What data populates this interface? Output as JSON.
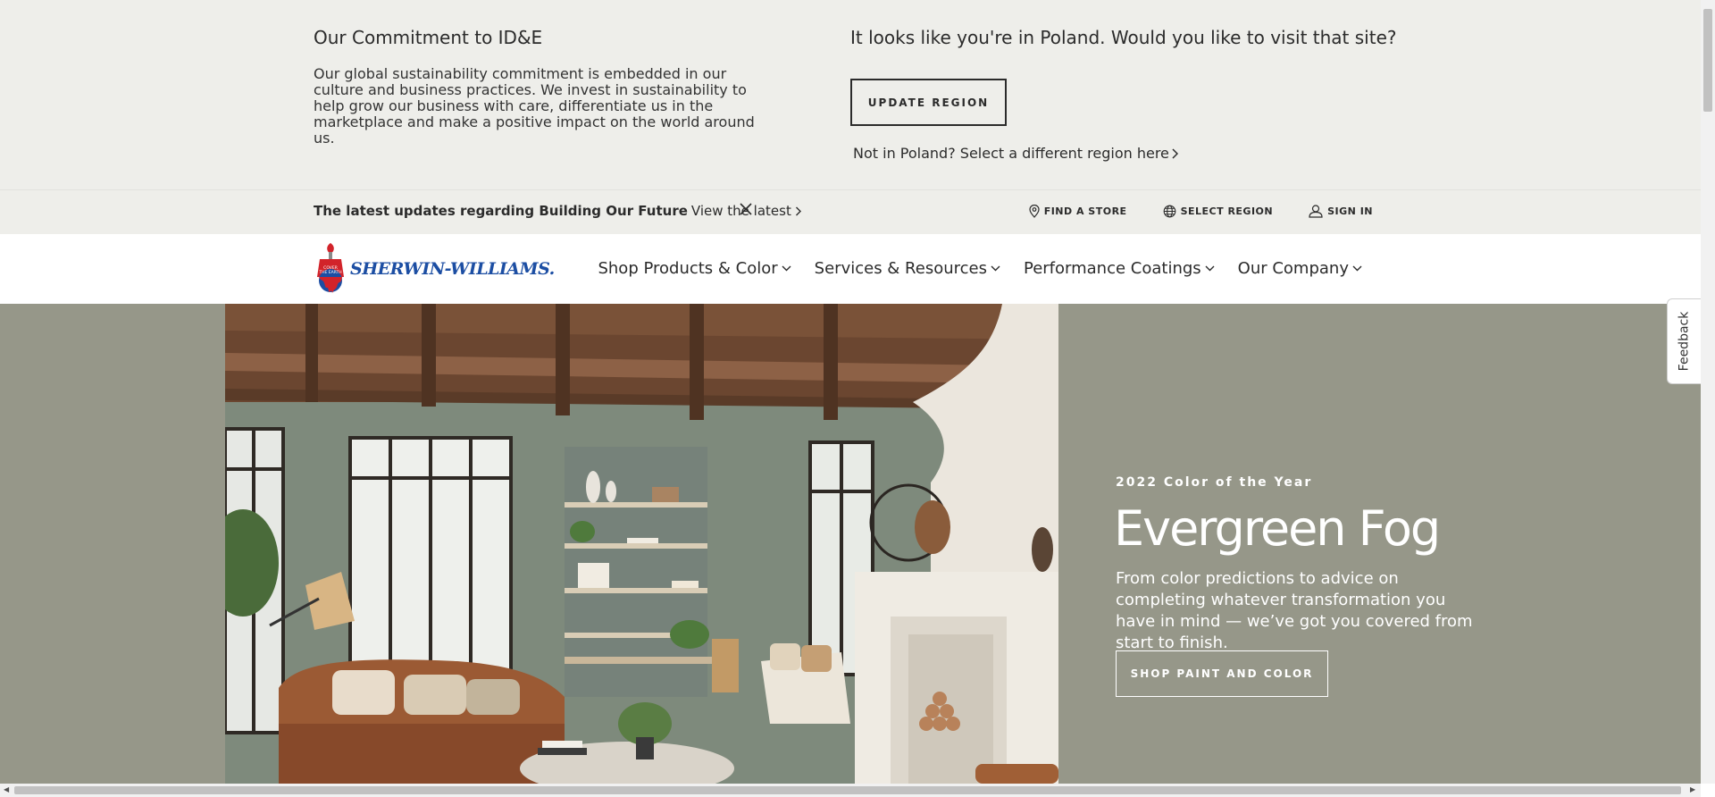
{
  "region_banner": {
    "commitment_title": "Our Commitment to ID&E",
    "commitment_text": "Our global sustainability commitment is embedded in our culture and business practices. We invest in sustainability to help grow our business with care, differentiate us in the marketplace and make a positive impact on the world around us.",
    "region_question": "It looks like you're in Poland. Would you like to visit that site?",
    "update_button": "UPDATE REGION",
    "different_region_link": "Not in Poland? Select a different region here"
  },
  "utility_bar": {
    "update_bold": "The latest updates regarding Building Our Future",
    "view_latest": "View the latest",
    "links": [
      {
        "label": "FIND A STORE",
        "icon": "map-pin-icon"
      },
      {
        "label": "SELECT REGION",
        "icon": "globe-icon"
      },
      {
        "label": "SIGN IN",
        "icon": "user-icon"
      }
    ]
  },
  "header": {
    "logo_text": "SHERWIN-WILLIAMS.",
    "nav": [
      {
        "label": "Shop Products & Color"
      },
      {
        "label": "Services & Resources"
      },
      {
        "label": "Performance Coatings"
      },
      {
        "label": "Our Company"
      }
    ]
  },
  "hero": {
    "eyebrow": "2022 Color of the Year",
    "title": "Evergreen Fog",
    "body": "From color predictions to advice on completing whatever transformation you have in mind — we’ve got you covered from start to finish.",
    "cta": "SHOP PAINT AND COLOR"
  },
  "feedback": {
    "label": "Feedback"
  },
  "colors": {
    "banner_bg": "#eeeeea",
    "hero_bg": "#969789",
    "logo_blue": "#1c4ea3",
    "logo_red": "#d2232a"
  }
}
